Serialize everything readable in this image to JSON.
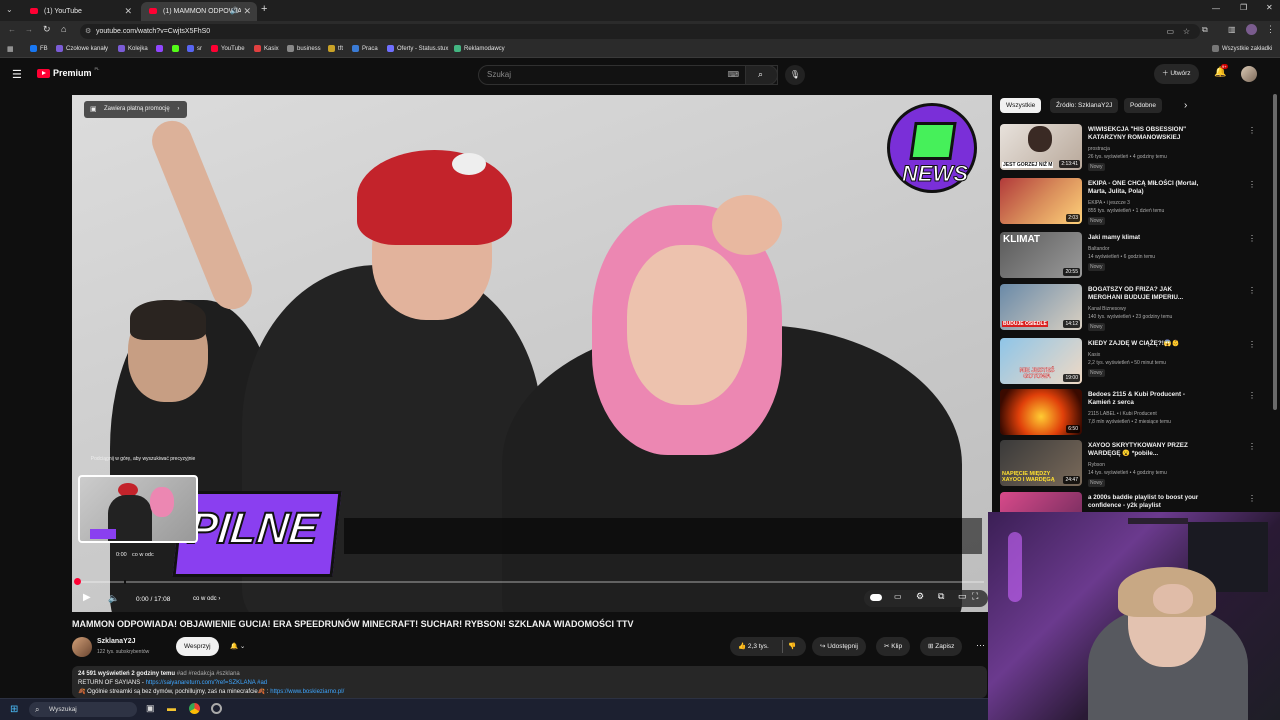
{
  "browser": {
    "tabs": [
      {
        "label": "(1) YouTube"
      },
      {
        "label": "(1) MAMMON ODPOWIADA"
      }
    ],
    "url": "youtube.com/watch?v=CwjtsX5FhS0",
    "bookmarks": [
      "FB",
      "Czołowe kanały",
      "Kolejka",
      "sr",
      "YouTube",
      "Kasix",
      "business",
      "tft",
      "Praca",
      "Oferty - Status.stux",
      "Reklamodawcy"
    ],
    "all_bookmarks": "Wszystkie zakładki"
  },
  "header": {
    "logo": "Premium",
    "logo_sup": "PL",
    "search_placeholder": "Szukaj",
    "create_label": "Utwórz",
    "notif_count": "9+"
  },
  "player": {
    "promo": "Zawiera płatną promocję",
    "news_logo": "NEWS",
    "overlay_word": "PILNE",
    "seek_hint": "Podciągnij w górę, aby wyszukiwać precyzyjnie",
    "preview_time": "0:00",
    "preview_chapter": "co w odc",
    "time": "0:00 / 17:08",
    "chapter": "co w odc",
    "progress_fraction": 0.0
  },
  "sidebar": {
    "chips": [
      "Wszystkie",
      "Źródło: SzklanaY2J",
      "Podobne"
    ],
    "videos": [
      {
        "title": "WIWISEKCJA \"HIS OBSESSION\" KATARZYNY ROMANOWSKIEJ",
        "channel": "prostracja",
        "meta": "26 tys. wyświetleń • 4 godziny temu",
        "badge": "Nowy",
        "duration": "2:13:41",
        "thumb_text": "JEST GORZEJ NIŻ M"
      },
      {
        "title": "EKIPA - ONE CHCĄ MIŁOŚCI (Mortal, Marta, Julita, Pola)",
        "channel": "EKIPA • i jeszcze 3",
        "meta": "855 tys. wyświetleń • 1 dzień temu",
        "badge": "Nowy",
        "duration": "2:03",
        "thumb_text": ""
      },
      {
        "title": "Jaki mamy klimat",
        "channel": "Baltandor",
        "meta": "14 wyświetleń • 6 godzin temu",
        "badge": "Nowy",
        "duration": "20:55",
        "thumb_text": "KLIMAT"
      },
      {
        "title": "BOGATSZY OD FRIZA? JAK MERGHANI BUDUJE IMPERIU...",
        "channel": "Kanał Biznesowy",
        "meta": "140 tys. wyświetleń • 23 godziny temu",
        "badge": "Nowy",
        "duration": "14:12",
        "thumb_text": "BUDUJE OSIEDLE"
      },
      {
        "title": "KIEDY ZAJDĘ W CIĄŻĘ?!😱👶",
        "channel": "Kasix",
        "meta": "2,2 tys. wyświetleń • 50 minut temu",
        "badge": "Nowy",
        "duration": "19:00",
        "thumb_text": "NIE JESTEŚ GOTOWA"
      },
      {
        "title": "Bedoes 2115 & Kubi Producent - Kamień z serca",
        "channel": "2115 LABEL • i Kubi Producent",
        "meta": "7,8 mln wyświetleń • 2 miesiące temu",
        "badge": "",
        "duration": "6:50",
        "thumb_text": ""
      },
      {
        "title": "XAYOO SKRYTYKOWANY PRZEZ WARDĘGĘ 😮 *pobile...",
        "channel": "Rybson",
        "meta": "14 tys. wyświetleń • 4 godziny temu",
        "badge": "Nowy",
        "duration": "24:47",
        "thumb_text": "NAPIĘCIE MIĘDZY XAYOO I WARDĘGĄ"
      },
      {
        "title": "a 2000s baddie playlist to boost your confidence - y2k playlist",
        "channel": "",
        "meta": "",
        "badge": "",
        "duration": "",
        "thumb_text": ""
      }
    ]
  },
  "video": {
    "title": "MAMMON ODPOWIADA! OBJAWIENIE GUCIA! ERA SPEEDRUNÓW MINECRAFT! SUCHAR! RYBSON! SZKLANA WIADOMOŚCI TTV",
    "channel": "SzklanaY2J",
    "subscribers": "122 tys. subskrybentów",
    "support": "Wesprzyj",
    "likes": "2,3 tys.",
    "share": "Udostępnij",
    "clip": "Klip",
    "save": "Zapisz",
    "desc_stats": "24 591 wyświetleń  2 godziny temu",
    "desc_tags": "#ad #redakcja #szklana",
    "desc_line1": "RETURN OF SAYIANS - ",
    "desc_link1": "https://saiyanareturn.com/?ref=SZKLANA #ad",
    "desc_line2": "🍂 Ogólnie streamki są bez dymów, pochillujmy, zaś na minecrafcie🍂 : ",
    "desc_link2": "https://www.boskieziarno.pl/"
  },
  "taskbar": {
    "search": "Wyszukaj"
  }
}
